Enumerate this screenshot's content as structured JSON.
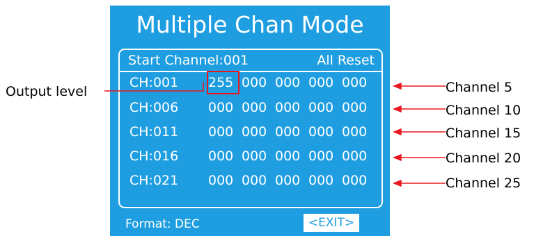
{
  "screen": {
    "title": "Multiple Chan Mode",
    "start_channel_label": "Start Channel:001",
    "all_reset_label": "All Reset",
    "rows": [
      {
        "channel": "CH:001",
        "values": [
          "255",
          "000",
          "000",
          "000",
          "000"
        ]
      },
      {
        "channel": "CH:006",
        "values": [
          "000",
          "000",
          "000",
          "000",
          "000"
        ]
      },
      {
        "channel": "CH:011",
        "values": [
          "000",
          "000",
          "000",
          "000",
          "000"
        ]
      },
      {
        "channel": "CH:016",
        "values": [
          "000",
          "000",
          "000",
          "000",
          "000"
        ]
      },
      {
        "channel": "CH:021",
        "values": [
          "000",
          "000",
          "000",
          "000",
          "000"
        ]
      }
    ],
    "format_label": "Format: DEC",
    "exit_label": "<EXIT>"
  },
  "annotations": {
    "output_level": "Output level",
    "channel_labels": [
      "Channel 5",
      "Channel 10",
      "Channel 15",
      "Channel 20",
      "Channel 25"
    ]
  },
  "colors": {
    "screen_bg": "#1e9ee0",
    "text": "#ffffff",
    "highlight": "#e8181e",
    "arrow": "#e8181e"
  }
}
